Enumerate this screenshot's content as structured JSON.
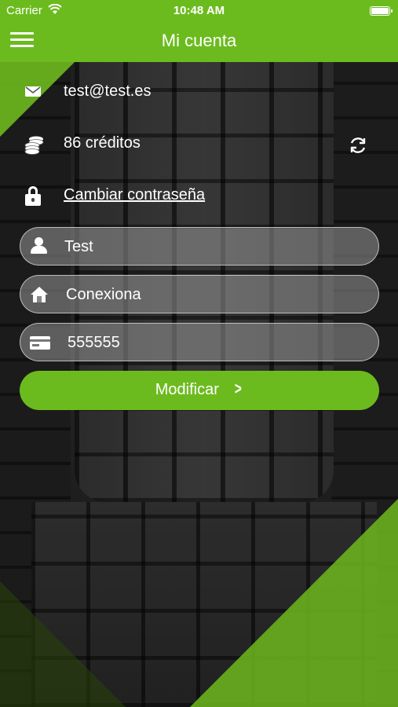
{
  "status_bar": {
    "carrier": "Carrier",
    "time": "10:48 AM"
  },
  "navbar": {
    "title": "Mi cuenta"
  },
  "account": {
    "email": "test@test.es",
    "credits": "86 créditos",
    "change_password": "Cambiar contraseña"
  },
  "form": {
    "name": "Test",
    "company": "Conexiona",
    "card": "555555"
  },
  "actions": {
    "modify_label": "Modificar"
  },
  "colors": {
    "brand_green": "#6cbb1e"
  },
  "icons": [
    "menu-icon",
    "mail-icon",
    "coins-icon",
    "refresh-icon",
    "lock-icon",
    "user-icon",
    "home-icon",
    "card-icon",
    "chevron-right-icon"
  ]
}
